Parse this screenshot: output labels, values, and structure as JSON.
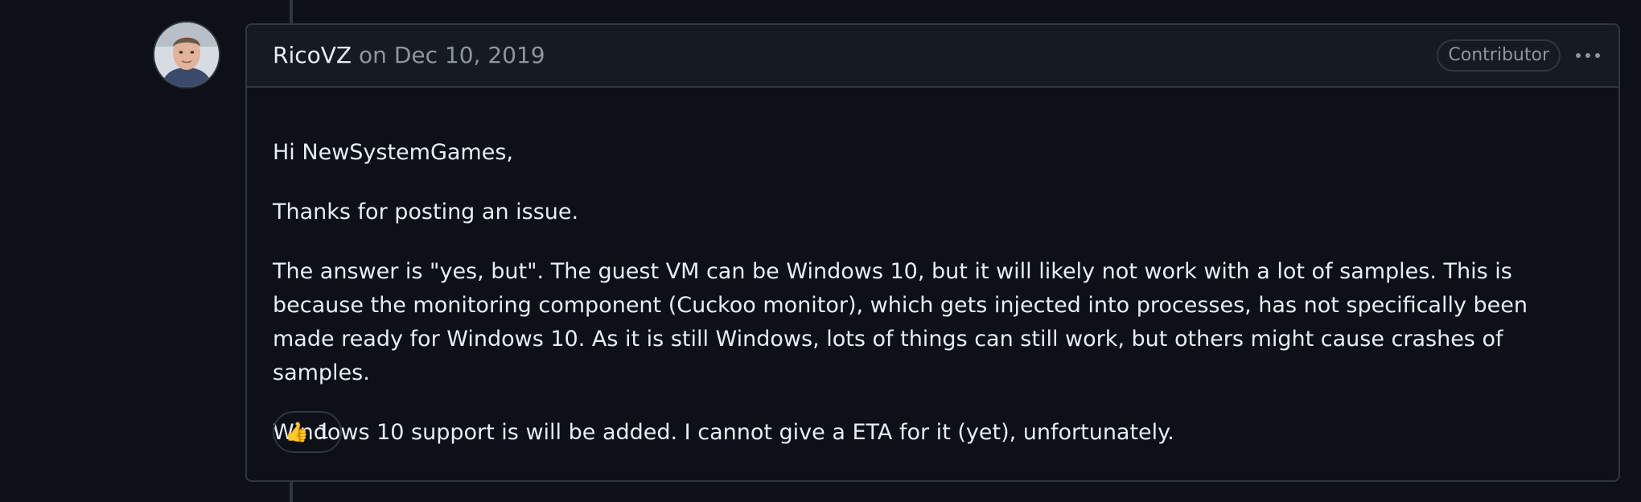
{
  "comment": {
    "author": "RicoVZ",
    "on_word": "on",
    "date": "Dec 10, 2019",
    "badge": "Contributor",
    "paragraphs": [
      "Hi NewSystemGames,",
      "Thanks for posting an issue.",
      "The answer is \"yes, but\". The guest VM can be Windows 10, but it will likely not work with a lot of samples. This is because the monitoring component (Cuckoo monitor), which gets injected into processes, has not specifically been made ready for Windows 10. As it is still Windows, lots of things can still work, but others might cause crashes of samples.",
      "Windows 10 support is will be added. I cannot give a ETA for it (yet), unfortunately."
    ],
    "reaction": {
      "emoji": "👍",
      "icon": "thumbs-up-icon",
      "count": "1"
    }
  },
  "colors": {
    "background": "#0d1117",
    "header_background": "#161b22",
    "border": "#30363d",
    "text": "#e6edf3",
    "muted_text": "#8d96a0"
  }
}
